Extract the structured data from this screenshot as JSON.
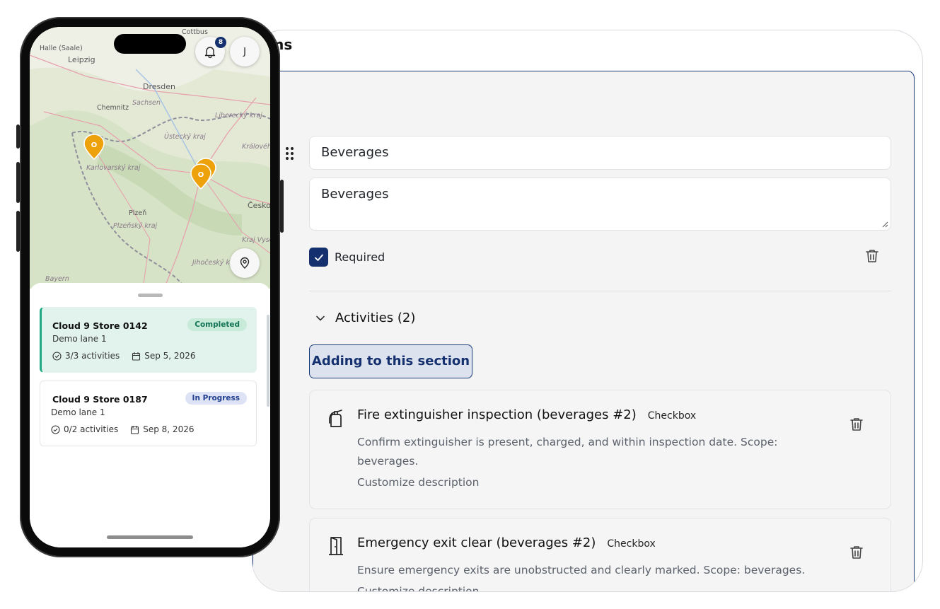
{
  "desktop": {
    "page_title_partial": "tions",
    "section": {
      "title_value": "Beverages",
      "description_value": "Beverages",
      "required_label": "Required",
      "required_checked": true,
      "activities_label": "Activities (2)",
      "adding_button": "Adding to this section",
      "activities": [
        {
          "icon": "fire-extinguisher-icon",
          "title": "Fire extinguisher inspection (beverages #2)",
          "type": "Checkbox",
          "description": "Confirm extinguisher is present, charged, and within inspection date. Scope: beverages.",
          "customize": "Customize description"
        },
        {
          "icon": "emergency-exit-door-icon",
          "title": "Emergency exit clear (beverages #2)",
          "type": "Checkbox",
          "description": "Ensure emergency exits are unobstructed and clearly marked. Scope: beverages.",
          "customize": "Customize description"
        }
      ]
    },
    "colors": {
      "accent": "#15306e",
      "border_accent": "#1b3a7a",
      "completed": "#1fa883"
    }
  },
  "phone": {
    "notification_count": "8",
    "avatar_initial": "J",
    "map_labels": [
      "Cottbus",
      "Halle (Saale)",
      "Leipzig",
      "Dresden",
      "Chemnitz",
      "Sachsen",
      "Liberecký kraj",
      "Ústecký kraj",
      "Karlovarský kraj",
      "Královéh",
      "Plzeň",
      "Plzeňský kraj",
      "Česko",
      "Kraj Vyso",
      "Jihočeský kraj",
      "Bayern"
    ],
    "map_marker_letter": "O",
    "stores": [
      {
        "name": "Cloud 9 Store 0142",
        "lane": "Demo lane 1",
        "activities": "3/3 activities",
        "date": "Sep 5, 2026",
        "status": "Completed"
      },
      {
        "name": "Cloud 9 Store 0187",
        "lane": "Demo lane 1",
        "activities": "0/2 activities",
        "date": "Sep 8, 2026",
        "status": "In Progress"
      }
    ]
  }
}
